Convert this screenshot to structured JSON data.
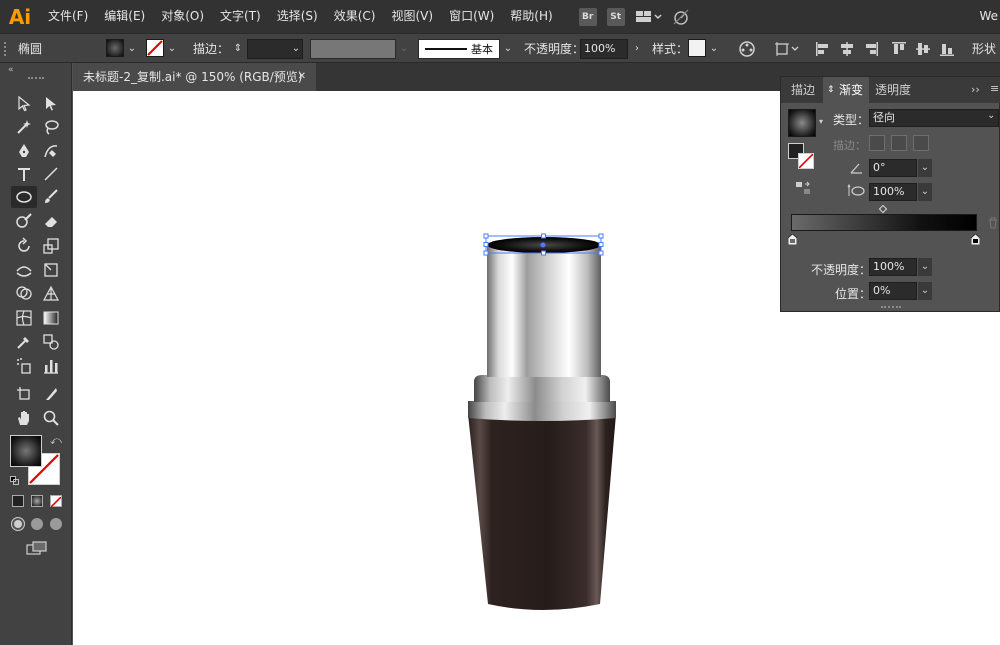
{
  "app": {
    "logo": "Ai",
    "workspace_label": "We"
  },
  "menu": [
    "文件(F)",
    "编辑(E)",
    "对象(O)",
    "文字(T)",
    "选择(S)",
    "效果(C)",
    "视图(V)",
    "窗口(W)",
    "帮助(H)"
  ],
  "menubar_icons": {
    "bridge": "Br",
    "stock": "St"
  },
  "control": {
    "object_type": "椭圆",
    "stroke_label": "描边：",
    "stroke_style": "基本",
    "opacity_label": "不透明度：",
    "opacity_value": "100%",
    "style_label": "样式：",
    "shape_label": "形状"
  },
  "document": {
    "tab_title": "未标题-2_复制.ai* @ 150% (RGB/预览)",
    "close_glyph": "✕"
  },
  "gradient_panel": {
    "tabs": [
      "描边",
      "渐变",
      "透明度"
    ],
    "type_label": "类型：",
    "type_value": "径向",
    "stroke_label": "描边：",
    "angle_value": "0°",
    "aspect_value": "100%",
    "opacity_label": "不透明度：",
    "opacity_value": "100%",
    "position_label": "位置：",
    "position_value": "0%",
    "expand_glyph": "››",
    "menu_glyph": "≡"
  },
  "colors": {
    "ui_dark": "#323232",
    "ui_mid": "#424242",
    "ui_panel": "#535353",
    "logo": "#ff9a00",
    "canvas": "#ffffff",
    "selection": "#4a7bff"
  }
}
